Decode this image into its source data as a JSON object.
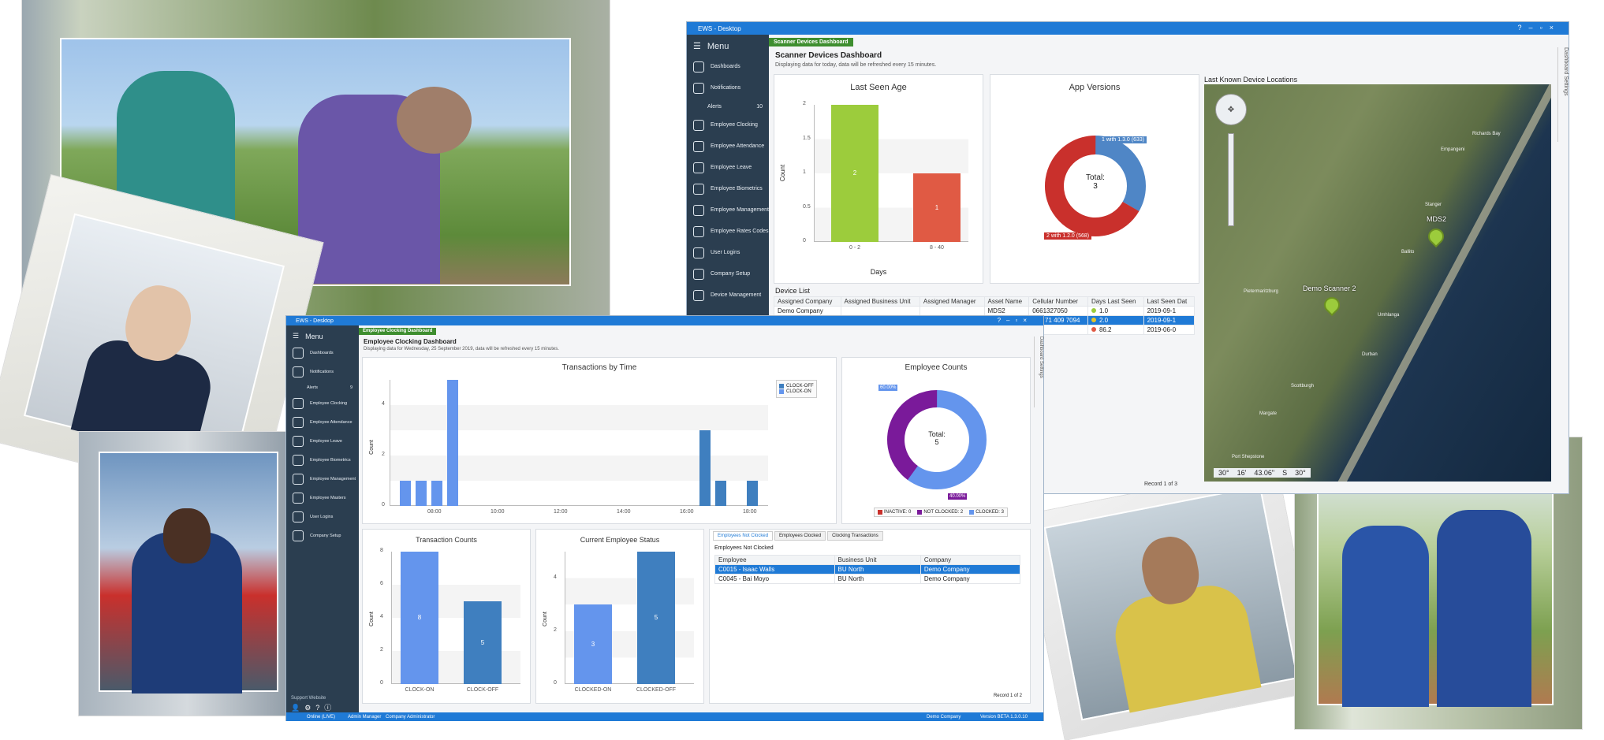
{
  "window_top": {
    "title": "EWS - Desktop",
    "tab": "Scanner Devices Dashboard",
    "menu": "Menu",
    "sidebar": [
      "Dashboards",
      "Notifications",
      "Alerts",
      "Employee Clocking",
      "Employee Attendance",
      "Employee Leave",
      "Employee Biometrics",
      "Employee Management",
      "Employee Rates Codes",
      "User Logins",
      "Company Setup",
      "Device Management"
    ],
    "alerts_count": "10",
    "heading": "Scanner Devices Dashboard",
    "subheading": "Displaying data for today, data will be refreshed every 15 minutes.",
    "side_tab": "Dashboard Settings",
    "last_seen": {
      "title": "Last Seen Age",
      "ylabel": "Count",
      "xlabel": "Days",
      "yticks": [
        "2",
        "1.5",
        "1",
        "0.5",
        "0"
      ]
    },
    "app_versions": {
      "title": "App Versions",
      "center_line1": "Total:",
      "center_line2": "3",
      "label_blue": "1 with 1.3.0 (633)",
      "label_red": "2 with 1.2.0 (568)"
    },
    "map": {
      "title": "Last Known Device Locations",
      "marker1": "MDS2",
      "marker2": "Demo Scanner 2",
      "coords": [
        "30°",
        "16'",
        "43.06\"",
        "S",
        "30°"
      ],
      "places": [
        "Margate",
        "Durban",
        "Scottburgh",
        "Richards Bay",
        "Empangeni",
        "Ballito",
        "Pietermaritzburg",
        "Stanger",
        "Umhlanga",
        "Port Shepstone"
      ]
    },
    "device_list": {
      "title": "Device List",
      "columns": [
        "Assigned Company",
        "Assigned Business Unit",
        "Assigned Manager",
        "Asset Name",
        "Cellular Number",
        "Days Last Seen",
        "Last Seen Dat"
      ],
      "rows": [
        [
          "Demo Company",
          "",
          "",
          "MDS2",
          "0661327050",
          "1.0",
          "2019-09-1"
        ],
        [
          "",
          "",
          "",
          "",
          "+27 71 409 7094",
          "2.0",
          "2019-09-1"
        ],
        [
          "",
          "",
          "",
          "",
          "",
          "86.2",
          "2019-06-0"
        ]
      ],
      "pager": "Record 1 of 3"
    },
    "colors": {
      "titlebar": "#1f7ad6",
      "green_bar": "#9ccc3c",
      "red_bar": "#e05a44",
      "blue": "#4f86c6",
      "red_ring": "#c9302c"
    }
  },
  "chart_last_seen": {
    "type": "bar",
    "title": "Last Seen Age",
    "categories": [
      "0 - 2",
      "8 - 40"
    ],
    "values": [
      2,
      1
    ],
    "xlabel": "Days",
    "ylabel": "Count",
    "ylim": [
      0,
      2
    ]
  },
  "chart_app_versions": {
    "type": "pie",
    "title": "App Versions",
    "categories": [
      "1 with 1.3.0 (633)",
      "2 with 1.2.0 (568)"
    ],
    "values": [
      1,
      2
    ]
  },
  "window_front": {
    "title": "EWS - Desktop",
    "tab": "Employee Clocking Dashboard",
    "menu": "Menu",
    "sidebar": [
      "Dashboards",
      "Notifications",
      "Alerts",
      "Employee Clocking",
      "Employee Attendance",
      "Employee Leave",
      "Employee Biometrics",
      "Employee Management",
      "Employee Masters",
      "User Logins",
      "Company Setup"
    ],
    "alerts_count": "9",
    "support": "Support Website",
    "heading": "Employee Clocking Dashboard",
    "subheading": "Displaying data for Wednesday, 25 September 2019, data will be refreshed every 15 minutes.",
    "side_tab": "Dashboard Settings",
    "transactions": {
      "title": "Transactions by Time",
      "ylabel": "Count",
      "yticks": [
        "4",
        "2",
        "0"
      ],
      "xticks": [
        "08:00",
        "10:00",
        "12:00",
        "14:00",
        "16:00",
        "18:00"
      ],
      "legend": [
        "CLOCK-OFF",
        "CLOCK-ON"
      ]
    },
    "employee_counts": {
      "title": "Employee Counts",
      "center_line1": "Total:",
      "center_line2": "5",
      "label_top": "60.00%",
      "label_bottom": "40.00%",
      "legend": [
        "INACTIVE: 0",
        "NOT CLOCKED: 2",
        "CLOCKED: 3"
      ]
    },
    "transaction_counts": {
      "title": "Transaction Counts",
      "ylabel": "Count",
      "yticks": [
        "8",
        "6",
        "4",
        "2",
        "0"
      ]
    },
    "current_status": {
      "title": "Current Employee Status",
      "ylabel": "Count",
      "yticks": [
        "4",
        "2",
        "0"
      ]
    },
    "tabs": [
      "Employees Not Clocked",
      "Employees Clocked",
      "Clocking Transactions"
    ],
    "not_clocked": {
      "title": "Employees Not Clocked",
      "columns": [
        "Employee",
        "Business Unit",
        "Company"
      ],
      "rows": [
        [
          "C0015 - Isaac Walls",
          "BU North",
          "Demo Company"
        ],
        [
          "C0045 - Bai Moyo",
          "BU North",
          "Demo Company"
        ]
      ],
      "pager": "Record 1 of 2"
    },
    "status_bar": {
      "online": "Online (LIVE)",
      "user": "Admin Manager",
      "role": "Company Administrator",
      "company": "Demo Company",
      "version": "Version BETA 1.3.0.10"
    },
    "colors": {
      "blue_light": "#6495ed",
      "blue_dark": "#3f7fbf",
      "purple": "#7a1a9a"
    }
  },
  "chart_transactions": {
    "type": "bar",
    "title": "Transactions by Time",
    "series": [
      {
        "name": "CLOCK-ON",
        "x": [
          "07:00",
          "07:30",
          "08:00",
          "08:30"
        ],
        "values": [
          1,
          1,
          1,
          5
        ]
      },
      {
        "name": "CLOCK-OFF",
        "x": [
          "16:30",
          "17:00",
          "18:00"
        ],
        "values": [
          3,
          1,
          1
        ]
      }
    ],
    "ylabel": "Count",
    "ylim": [
      0,
      5
    ]
  },
  "chart_transaction_counts": {
    "type": "bar",
    "title": "Transaction Counts",
    "categories": [
      "CLOCK-ON",
      "CLOCK-OFF"
    ],
    "values": [
      8,
      5
    ],
    "ylabel": "Count",
    "ylim": [
      0,
      8
    ]
  },
  "chart_current_status": {
    "type": "bar",
    "title": "Current Employee Status",
    "categories": [
      "CLOCKED-ON",
      "CLOCKED-OFF"
    ],
    "values": [
      3,
      5
    ],
    "ylabel": "Count",
    "ylim": [
      0,
      5
    ]
  },
  "chart_employee_counts": {
    "type": "pie",
    "title": "Employee Counts",
    "categories": [
      "INACTIVE: 0",
      "NOT CLOCKED: 2",
      "CLOCKED: 3"
    ],
    "values": [
      0,
      2,
      3
    ]
  }
}
